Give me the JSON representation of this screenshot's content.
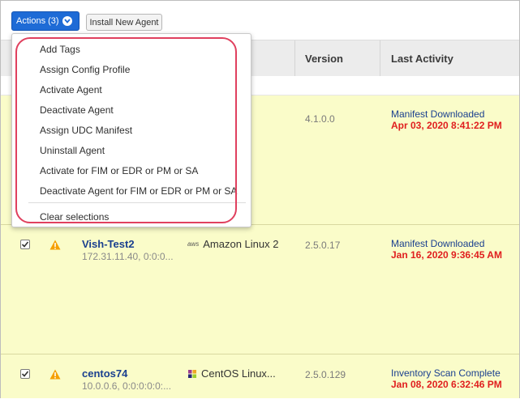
{
  "toolbar": {
    "actions_label": "Actions (3)",
    "install_label": "Install New Agent"
  },
  "menu": {
    "items": [
      "Add Tags",
      "Assign Config Profile",
      "Activate Agent",
      "Deactivate Agent",
      "Assign UDC Manifest",
      "Uninstall Agent",
      "Activate for FIM or EDR or PM or SA",
      "Deactivate Agent for FIM or EDR or PM or SA"
    ],
    "clear_label": "Clear selections"
  },
  "table": {
    "headers": {
      "version": "Version",
      "last_activity": "Last Activity"
    },
    "rows": [
      {
        "version": "4.1.0.0",
        "activity_status": "Manifest Downloaded",
        "activity_time": "Apr 03, 2020 8:41:22 PM"
      },
      {
        "name": "Vish-Test2",
        "ip": "172.31.11.40, 0:0:0...",
        "os": "Amazon Linux 2",
        "os_icon_text": "aws",
        "version": "2.5.0.17",
        "activity_status": "Manifest Downloaded",
        "activity_time": "Jan 16, 2020 9:36:45 AM"
      },
      {
        "name": "centos74",
        "ip": "10.0.0.6, 0:0:0:0:0:...",
        "os": "CentOS Linux...",
        "version": "2.5.0.129",
        "activity_status": "Inventory Scan Complete",
        "activity_time": "Jan 08, 2020 6:32:46 PM"
      }
    ]
  },
  "colors": {
    "accent": "#1e6bd6",
    "row_highlight": "#fafcc9",
    "alert_red": "#e01e1e",
    "link_blue": "#1a3f8f",
    "annotation_outline": "#e0405e"
  }
}
